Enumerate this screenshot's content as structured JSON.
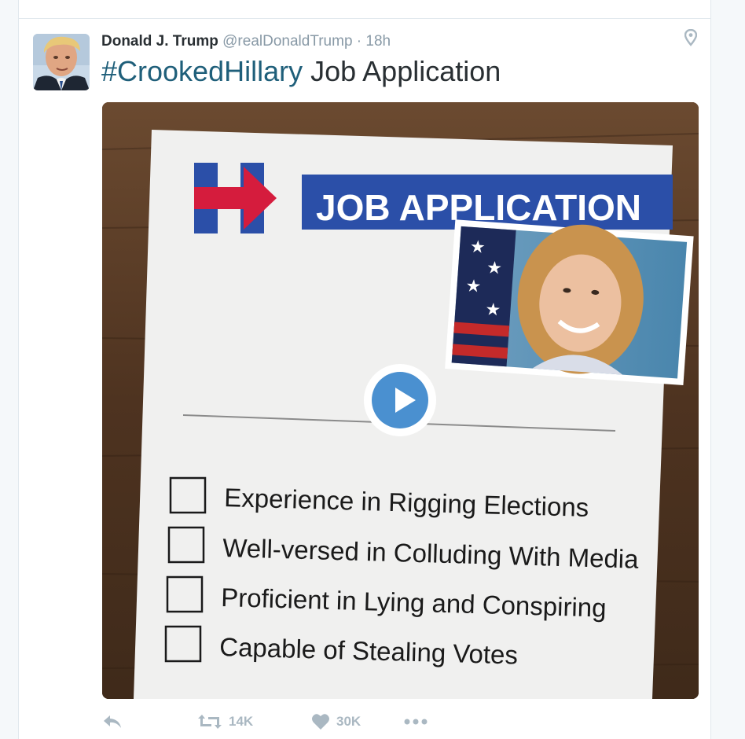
{
  "tweet": {
    "name": "Donald J. Trump",
    "handle": "@realDonaldTrump",
    "separator": "·",
    "time": "18h",
    "hashtag": "#CrookedHillary",
    "text": " Job Application",
    "geo_icon": "location-pin-icon"
  },
  "media": {
    "banner": "JOB APPLICATION",
    "checklist": [
      "Experience in Rigging Elections",
      "Well-versed in Colluding With Media",
      "Proficient in Lying and Conspiring",
      "Capable of Stealing Votes"
    ],
    "play_icon": "play-icon"
  },
  "actions": {
    "reply_icon": "reply-icon",
    "retweet_icon": "retweet-icon",
    "retweet_count": "14K",
    "like_icon": "heart-icon",
    "like_count": "30K",
    "more_icon": "more-icon"
  },
  "colors": {
    "brand_blue": "#2b4fa8",
    "brand_red": "#d51c3d",
    "link": "#1f5f7a",
    "action_gray": "#aab8c2"
  }
}
